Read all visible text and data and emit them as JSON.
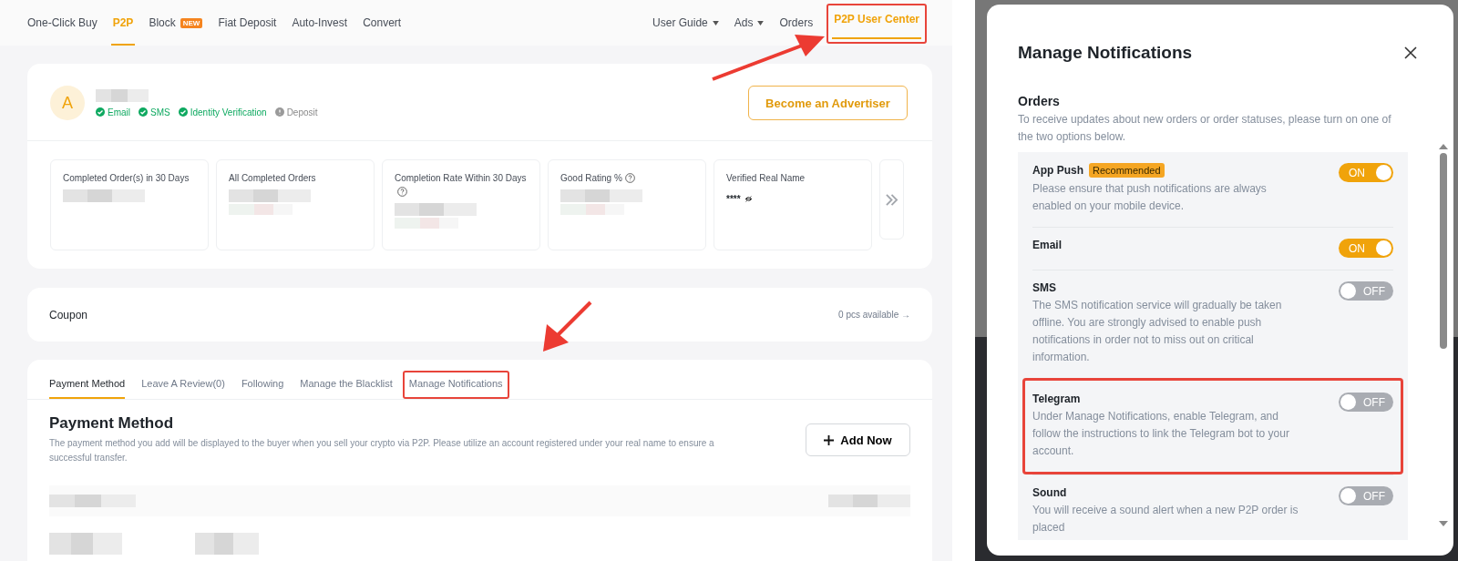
{
  "nav": {
    "left": [
      {
        "label": "One-Click Buy",
        "selected": false
      },
      {
        "label": "P2P",
        "selected": true
      },
      {
        "label": "Block",
        "selected": false,
        "badge": "NEW"
      },
      {
        "label": "Fiat Deposit",
        "selected": false
      },
      {
        "label": "Auto-Invest",
        "selected": false
      },
      {
        "label": "Convert",
        "selected": false
      }
    ],
    "right": [
      {
        "label": "User Guide",
        "selected": false,
        "caret": true,
        "highlighted": false
      },
      {
        "label": "Ads",
        "selected": false,
        "caret": true,
        "highlighted": false
      },
      {
        "label": "Orders",
        "selected": false,
        "caret": false,
        "highlighted": false
      },
      {
        "label": "P2P User Center",
        "selected": true,
        "caret": false,
        "highlighted": true
      }
    ]
  },
  "profile": {
    "avatar": "A",
    "verifications": [
      {
        "label": "Email",
        "verified": true
      },
      {
        "label": "SMS",
        "verified": true
      },
      {
        "label": "Identity Verification",
        "verified": true
      },
      {
        "label": "Deposit",
        "verified": false
      }
    ],
    "button": "Become an Advertiser"
  },
  "stats": [
    {
      "label": "Completed Order(s) in 30 Days",
      "help": false
    },
    {
      "label": "All Completed Orders",
      "help": false
    },
    {
      "label": "Completion Rate Within 30 Days",
      "help": true
    },
    {
      "label": "Good Rating %",
      "help": true
    },
    {
      "label": "Verified Real Name",
      "help": false,
      "value": "****"
    }
  ],
  "coupon": {
    "label": "Coupon",
    "link": "0 pcs available →"
  },
  "tabs": [
    {
      "label": "Payment Method",
      "selected": true,
      "highlighted": false
    },
    {
      "label": "Leave A Review(0)",
      "selected": false,
      "highlighted": false
    },
    {
      "label": "Following",
      "selected": false,
      "highlighted": false
    },
    {
      "label": "Manage the Blacklist",
      "selected": false,
      "highlighted": false
    },
    {
      "label": "Manage Notifications",
      "selected": false,
      "highlighted": true
    }
  ],
  "payment": {
    "title": "Payment Method",
    "description": "The payment method you add will be displayed to the buyer when you sell your crypto via P2P. Please utilize an account registered under your real name to ensure a successful transfer.",
    "button": "Add Now"
  },
  "modal": {
    "title": "Manage Notifications",
    "section_title": "Orders",
    "section_description": "To receive updates about new orders or order statuses, please turn on one of the two options below.",
    "options": [
      {
        "label": "App Push",
        "badge": "Recommended",
        "description": "Please ensure that push notifications are always enabled on your mobile device.",
        "on": true,
        "toggle_text": "ON",
        "highlighted": false
      },
      {
        "label": "Email",
        "on": true,
        "toggle_text": "ON",
        "highlighted": false
      },
      {
        "label": "SMS",
        "description": "The SMS notification service will gradually be taken offline. You are strongly advised to enable push notifications in order not to miss out on critical information.",
        "on": false,
        "toggle_text": "OFF",
        "highlighted": false
      },
      {
        "label": "Telegram",
        "description": "Under Manage Notifications, enable Telegram, and follow the instructions to link the Telegram bot to your account.",
        "on": false,
        "toggle_text": "OFF",
        "highlighted": true
      },
      {
        "label": "Sound",
        "description": "You will receive a sound alert when a new P2P order is placed",
        "on": false,
        "toggle_text": "OFF",
        "highlighted": false
      }
    ]
  }
}
